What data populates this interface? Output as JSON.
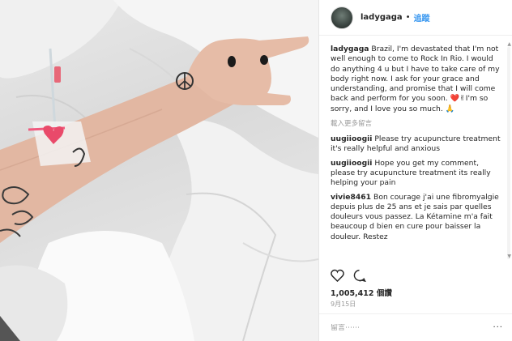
{
  "post": {
    "username": "ladygaga",
    "separator": "•",
    "follow_label": "追蹤"
  },
  "comments": [
    {
      "user": "ladygaga",
      "text": "Brazil, I'm devastated that I'm not well enough to come to Rock In Rio. I would do anything 4 u but I have to take care of my body right now. I ask for your grace and understanding, and promise that I will come back and perform for you soon. ❤️✌I'm so sorry, and I love you so much. 🙏"
    },
    {
      "user": "uugiioogii",
      "text": "Please try acupuncture treatment it's really helpful and anxious"
    },
    {
      "user": "uugiioogii",
      "text": "Hope you get my comment, please try acupuncture treatment its really helping your pain"
    },
    {
      "user": "vivie8461",
      "text": "Bon courage j'ai une fibromyalgie depuis plus de 25 ans et je sais par quelles douleurs vous passez. La Kétamine m'a fait beaucoup d bien en cure pour baisser la douleur. Restez"
    }
  ],
  "load_more_label": "載入更多留言",
  "likes_count": "1,005,412",
  "likes_suffix": "個讚",
  "date_label": "9月15日",
  "add_comment_placeholder": "留言⋯⋯",
  "more_icon": "···",
  "icons": {
    "like": "heart-icon",
    "comment": "comment-icon",
    "more": "more-options-icon"
  },
  "colors": {
    "link": "#3897f0",
    "heart_tattoo": "#e94a6a",
    "text": "#262626",
    "muted": "#999999"
  }
}
